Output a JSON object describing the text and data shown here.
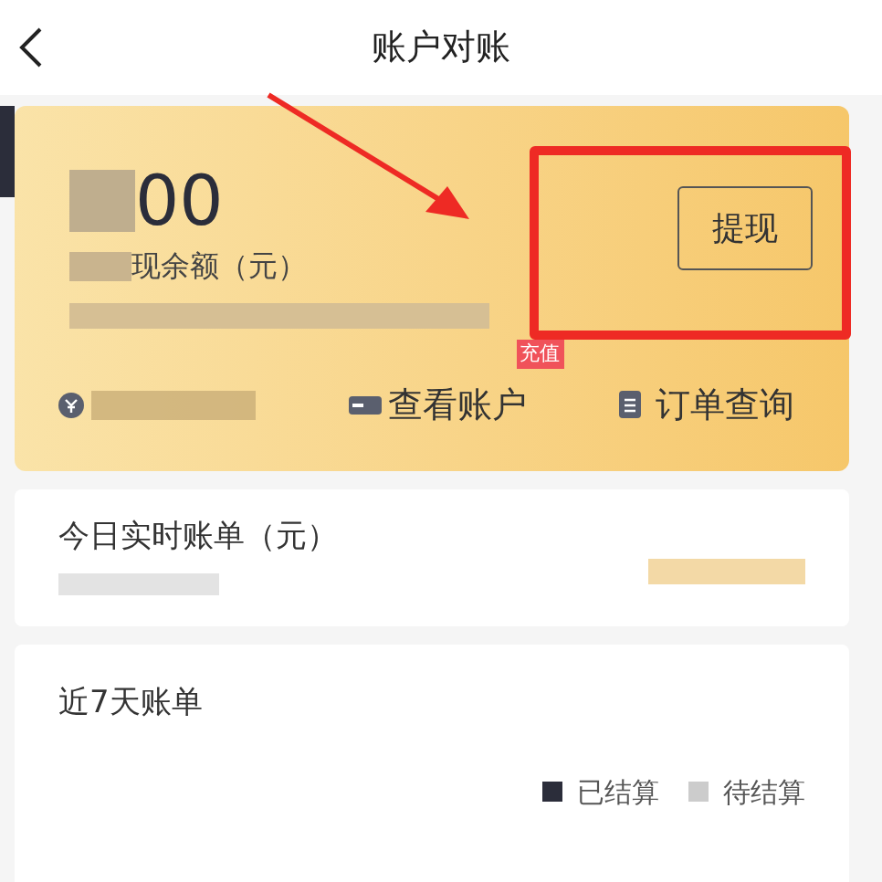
{
  "header": {
    "title": "账户对账"
  },
  "balance_card": {
    "amount": "00",
    "label": "现余额（元）",
    "withdraw_button": "提现",
    "actions": [
      {
        "kind": "hidden"
      },
      {
        "kind": "account",
        "label": "查看账户",
        "badge": "充值"
      },
      {
        "kind": "orders",
        "label": "订单查询"
      }
    ]
  },
  "today_card": {
    "title": "今日实时账单（元）"
  },
  "week_card": {
    "title": "近7天账单",
    "legend": [
      {
        "label": "已结算",
        "color": "#2b2d3a"
      },
      {
        "label": "待结算",
        "color": "#cccccc"
      }
    ]
  }
}
